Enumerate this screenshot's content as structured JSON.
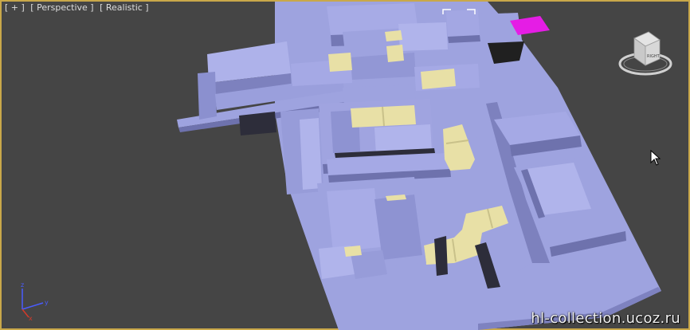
{
  "viewport": {
    "labels": [
      "[ + ]",
      "[ Perspective ]",
      "[ Realistic ]"
    ]
  },
  "viewcube": {
    "face_label": "RIGHT"
  },
  "gizmo": {
    "axes": [
      "x",
      "y",
      "z"
    ]
  },
  "watermark": "hl-collection.ucoz.ru",
  "colors": {
    "background": "#454545",
    "building": "#9ea3df",
    "building_dark": "#7e82c0",
    "building_light": "#b3b7ec",
    "accent_yellow": "#e8e0a6",
    "selection_magenta": "#e51de5",
    "viewport_border": "#c9a84a"
  },
  "icons": [
    "viewcube-icon",
    "axis-gizmo-icon",
    "mouse-cursor-icon",
    "selection-bracket-icon"
  ]
}
